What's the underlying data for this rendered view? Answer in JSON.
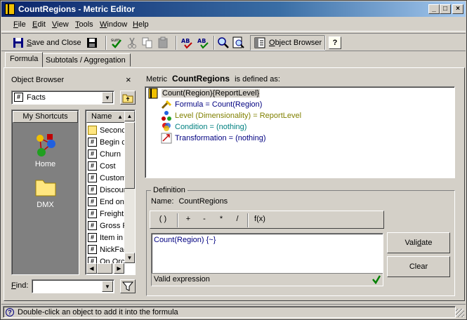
{
  "window": {
    "title": "CountRegions - Metric Editor",
    "controls": {
      "minimize": "_",
      "maximize": "□",
      "close": "×"
    }
  },
  "menu": [
    {
      "label": "File",
      "accel": "F",
      "rest": "ile"
    },
    {
      "label": "Edit",
      "accel": "E",
      "rest": "dit"
    },
    {
      "label": "View",
      "accel": "V",
      "rest": "iew"
    },
    {
      "label": "Tools",
      "accel": "T",
      "rest": "ools"
    },
    {
      "label": "Window",
      "accel": "W",
      "rest": "indow"
    },
    {
      "label": "Help",
      "accel": "H",
      "rest": "elp"
    }
  ],
  "toolbar": {
    "save_close_accel": "S",
    "save_close_rest": "ave and Close",
    "object_browser_accel": "O",
    "object_browser_rest": "bject Browser",
    "help_glyph": "?"
  },
  "tabs": [
    {
      "label": "Formula",
      "active": true
    },
    {
      "label": "Subtotals / Aggregation",
      "active": false
    }
  ],
  "object_browser": {
    "title": "Object Browser",
    "close_glyph": "×",
    "folder_combo_value": "Facts",
    "folder_combo_icon": "#",
    "shortcuts_header": "My Shortcuts",
    "shortcuts": [
      {
        "label": "Home",
        "icon": "home-network-icon"
      },
      {
        "label": "DMX",
        "icon": "folder-icon"
      }
    ],
    "list_header": "Name",
    "items": [
      {
        "label": "Seconc",
        "icon": "folder"
      },
      {
        "label": "Begin c",
        "icon": "fact"
      },
      {
        "label": "Churn",
        "icon": "fact"
      },
      {
        "label": "Cost",
        "icon": "fact"
      },
      {
        "label": "Custom",
        "icon": "fact"
      },
      {
        "label": "Discour",
        "icon": "fact"
      },
      {
        "label": "End on",
        "icon": "fact"
      },
      {
        "label": "Freight",
        "icon": "fact"
      },
      {
        "label": "Gross R",
        "icon": "fact"
      },
      {
        "label": "Item in",
        "icon": "fact"
      },
      {
        "label": "NickFac",
        "icon": "fact"
      },
      {
        "label": "On Orc",
        "icon": "fact"
      }
    ],
    "find_label_accel": "F",
    "find_label_rest": "ind:",
    "find_value": ""
  },
  "metric_header": {
    "prefix": "Metric",
    "name": "CountRegions",
    "suffix": "is defined as:"
  },
  "definition_tree": {
    "root": "Count(Region){ReportLevel}",
    "children": [
      {
        "label": "Formula = Count(Region)",
        "color": "#000080",
        "icon": "formula-icon"
      },
      {
        "label": "Level (Dimensionality) = ReportLevel",
        "color": "#808000",
        "icon": "level-icon"
      },
      {
        "label": "Condition = (nothing)",
        "color": "#008080",
        "icon": "condition-icon"
      },
      {
        "label": "Transformation = (nothing)",
        "color": "#000080",
        "icon": "transformation-icon"
      }
    ]
  },
  "definition": {
    "group_label": "Definition",
    "name_label": "Name:",
    "name_value": "CountRegions",
    "operators": [
      "( )",
      "+",
      "-",
      "*",
      "/",
      "f(x)"
    ],
    "formula_text": "Count(Region) {~}",
    "status": "Valid expression",
    "validate_accel": "d",
    "validate_pre": "Vali",
    "validate_post": "ate",
    "clear_label": "Clear"
  },
  "statusbar": {
    "text": "Double-click an object to add it into the formula"
  },
  "colors": {
    "title_gradient_start": "#0a246a",
    "title_gradient_end": "#a6caf0",
    "face": "#d4d0c8",
    "valid_check": "#008000"
  }
}
